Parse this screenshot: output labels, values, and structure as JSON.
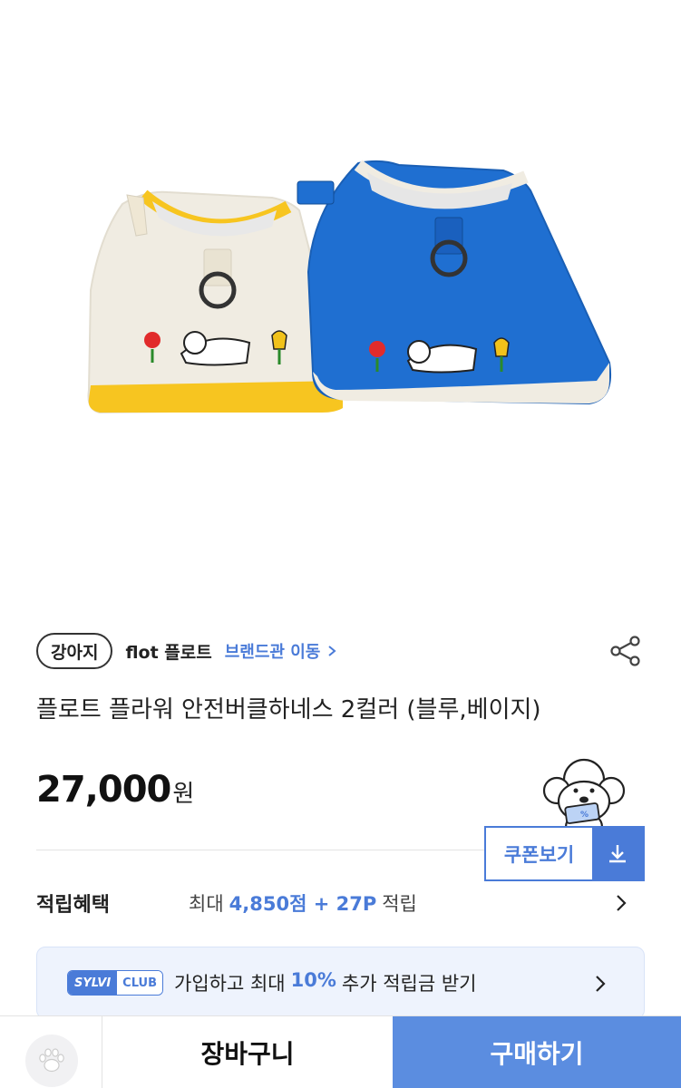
{
  "product": {
    "category_chip": "강아지",
    "brand_name": "flot 플로트",
    "brand_link": "브랜드관 이동",
    "title": "플로트 플라워 안전버클하네스 2컬러 (블루,베이지)",
    "price": "27,000",
    "price_unit": "원"
  },
  "coupon": {
    "label": "쿠폰보기"
  },
  "points": {
    "label": "적립혜택",
    "prefix": "최대",
    "amount": "4,850점 + 27P",
    "suffix": "적립"
  },
  "club": {
    "badge_a": "SYLVI",
    "badge_b": "CLUB",
    "text_pre": "가입하고 최대",
    "percent": "10%",
    "text_post": "추가 적립금 받기"
  },
  "bottom_bar": {
    "cart_label": "장바구니",
    "buy_label": "구매하기"
  },
  "icons": {
    "share": "share-icon",
    "chevron": "chevron-right-icon",
    "download": "download-icon",
    "paw": "paw-icon"
  },
  "colors": {
    "accent": "#4a7bd8",
    "buy_button": "#5b8de0",
    "harness_blue": "#1f6fd1",
    "harness_beige": "#f0ece2",
    "harness_yellow": "#f7c520"
  }
}
